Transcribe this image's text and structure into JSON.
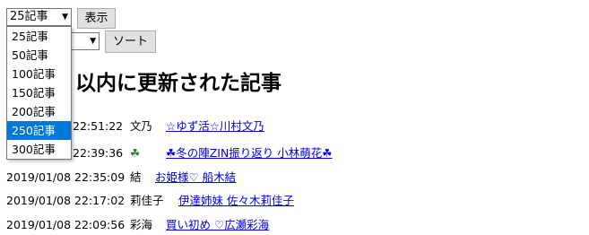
{
  "count_select": {
    "value": "25記事"
  },
  "show_button": "表示",
  "sort_select": {
    "value": ""
  },
  "sort_button": "ソート",
  "page_title": "以内に更新された記事",
  "dropdown": {
    "options": [
      "25記事",
      "50記事",
      "100記事",
      "150記事",
      "200記事",
      "250記事",
      "300記事"
    ],
    "highlighted": "250記事"
  },
  "posts": [
    {
      "time": "22:51:22",
      "author": "文乃",
      "title": "☆ゆず活☆川村文乃"
    },
    {
      "time": "22:39:36",
      "author": "☘",
      "title": "☘冬の陣ZIN振り返り 小林萌花☘"
    },
    {
      "time": "2019/01/08 22:35:09",
      "author": "結",
      "title": "お姫様♡ 船木結"
    },
    {
      "time": "2019/01/08 22:17:02",
      "author": "莉佳子",
      "title": "伊達姉妹 佐々木莉佳子"
    },
    {
      "time": "2019/01/08 22:09:56",
      "author": "彩海",
      "title": "買い初め ♡広瀬彩海"
    }
  ]
}
